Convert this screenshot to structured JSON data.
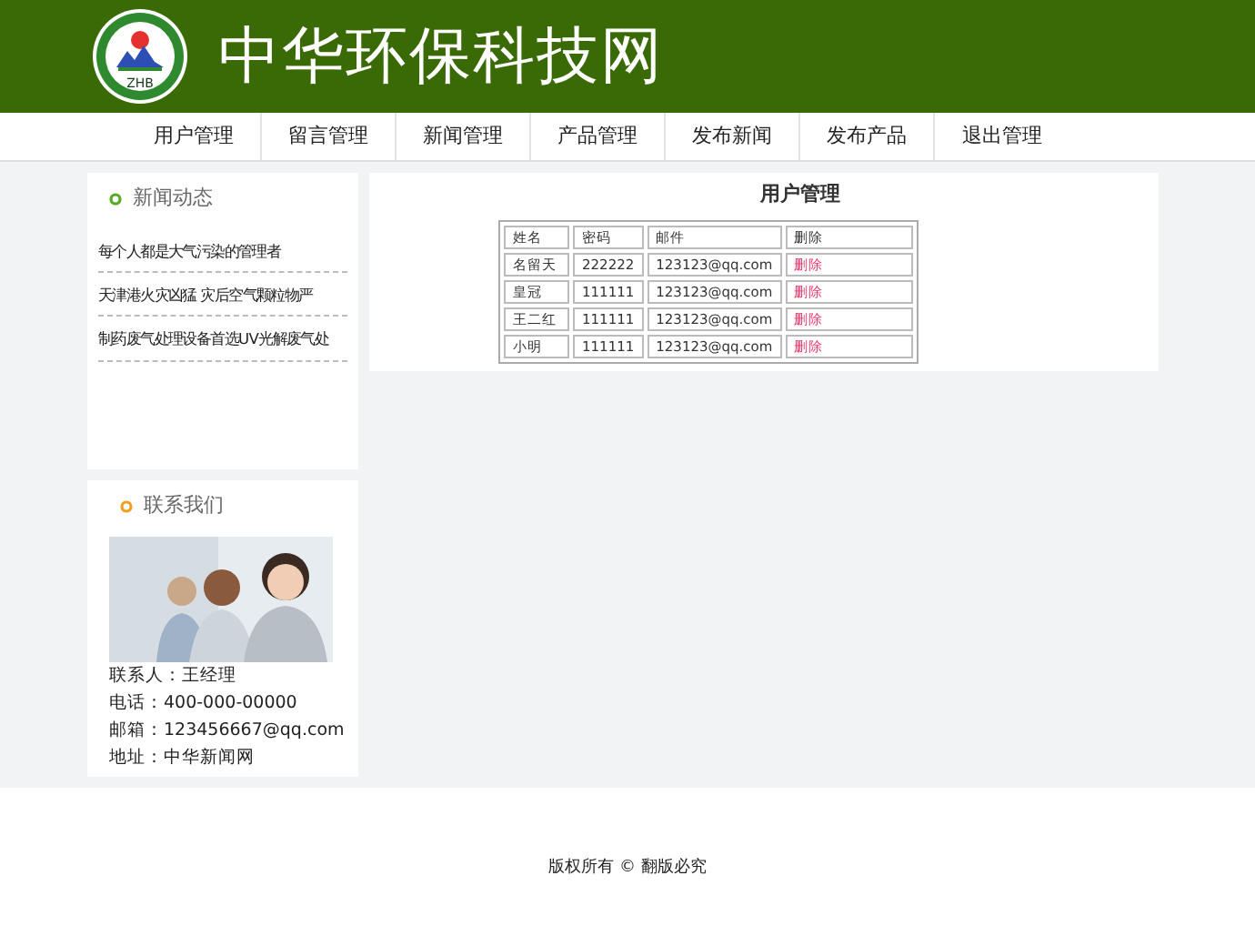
{
  "header": {
    "logo_text": "ZHB",
    "site_title": "中华环保科技网"
  },
  "nav": [
    "用户管理",
    "留言管理",
    "新闻管理",
    "产品管理",
    "发布新闻",
    "发布产品",
    "退出管理"
  ],
  "news": {
    "title": "新闻动态",
    "items": [
      "每个人都是大气污染的管理者",
      "天津港火灾凶猛 灾后空气颗粒物严",
      "制药废气处理设备首选UV光解废气处"
    ]
  },
  "contact": {
    "title": "联系我们",
    "lines": [
      "联系人：王经理",
      "电话：400-000-00000",
      "邮箱：123456667@qq.com",
      "地址：中华新闻网"
    ]
  },
  "main": {
    "title": "用户管理",
    "table": {
      "columns": [
        "姓名",
        "密码",
        "邮件",
        "删除"
      ],
      "rows": [
        [
          "名留天",
          "222222",
          "123123@qq.com",
          "删除"
        ],
        [
          "皇冠",
          "111111",
          "123123@qq.com",
          "删除"
        ],
        [
          "王二红",
          "111111",
          "123123@qq.com",
          "删除"
        ],
        [
          "小明",
          "111111",
          "123123@qq.com",
          "删除"
        ]
      ]
    }
  },
  "footer": "版权所有 © 翻版必究"
}
